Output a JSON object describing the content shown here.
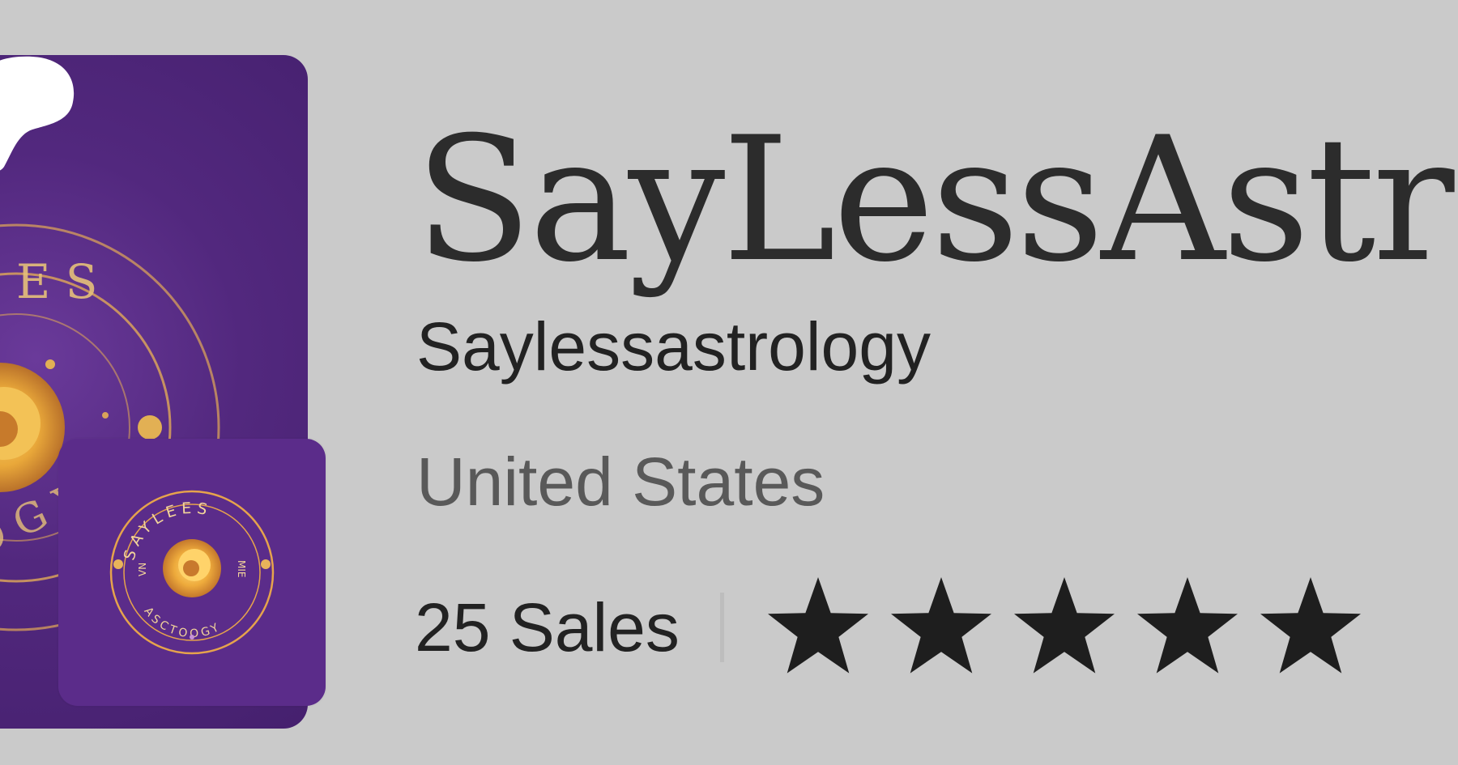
{
  "shop": {
    "name": "SayLessAstrol",
    "handle": "Saylessastrology",
    "location": "United States",
    "sales": "25 Sales",
    "rating": 5,
    "rating_max": 5
  },
  "banner": {
    "brand_mark": "patreon-logo",
    "colors": {
      "purple_dark": "#45206e",
      "purple": "#5b2c8a",
      "gold": "#e7a93c"
    }
  },
  "avatar": {
    "logo_top": "SAYLEES",
    "logo_bottom": "ASCTOOGY",
    "logo_left": "VN",
    "logo_right": "MIE"
  }
}
